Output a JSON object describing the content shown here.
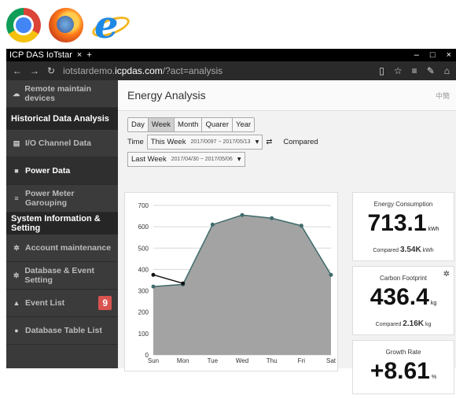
{
  "browser": {
    "tab_title": "ICP DAS IoTstar",
    "tab_close": "×",
    "tab_new": "+",
    "url_prefix": "iotstardemo.",
    "url_domain": "icpdas.com",
    "url_suffix": "/?act=analysis"
  },
  "sidebar": {
    "items_top": [
      {
        "label": "Remote maintain devices",
        "icon": "cloud-icon"
      }
    ],
    "section1": "Historical Data Analysis",
    "section1_items": [
      {
        "label": "I/O Channel Data",
        "icon": "io-icon",
        "active": false
      },
      {
        "label": "Power Data",
        "icon": "power-icon",
        "active": true
      },
      {
        "label": "Power Meter Garouping",
        "icon": "list-icon",
        "active": false
      }
    ],
    "section2": "System Information & Setting",
    "section2_items": [
      {
        "label": "Account maintenance",
        "icon": "gear-icon"
      },
      {
        "label": "Database & Event Setting",
        "icon": "gear-icon"
      },
      {
        "label": "Event List",
        "icon": "bell-icon",
        "badge": "9"
      },
      {
        "label": "Database Table List",
        "icon": "info-icon"
      }
    ]
  },
  "main": {
    "title": "Energy Analysis",
    "lang": "中簡",
    "period_buttons": [
      "Day",
      "Week",
      "Month",
      "Quarer",
      "Year"
    ],
    "time_label": "Time",
    "this_week_label": "This Week",
    "this_week_range": "2017/0097 ~ 2017/05/13",
    "compared_label": "Compared",
    "last_week_label": "Last Week",
    "last_week_range": "2017/04/30 ~ 2017/05/06"
  },
  "kpis": [
    {
      "title": "Energy Consumption",
      "value": "713.1",
      "unit": "kWh",
      "compared_label": "Compared",
      "compared_value": "3.54K",
      "compared_unit": "kWh"
    },
    {
      "title": "Carbon Footprint",
      "value": "436.4",
      "unit": "kg",
      "compared_label": "Compared",
      "compared_value": "2.16K",
      "compared_unit": "kg"
    },
    {
      "title": "Growth Rate",
      "value": "+8.61",
      "unit": "%"
    }
  ],
  "chart_data": {
    "type": "area",
    "categories": [
      "Sun",
      "Mon",
      "Tue",
      "Wed",
      "Thu",
      "Fri",
      "Sat"
    ],
    "ylim": [
      0,
      700
    ],
    "yticks": [
      0,
      100,
      200,
      300,
      400,
      500,
      600,
      700
    ],
    "series": [
      {
        "values": [
          320,
          330,
          610,
          655,
          640,
          605,
          375
        ]
      },
      {
        "values": [
          375,
          335
        ]
      }
    ]
  }
}
